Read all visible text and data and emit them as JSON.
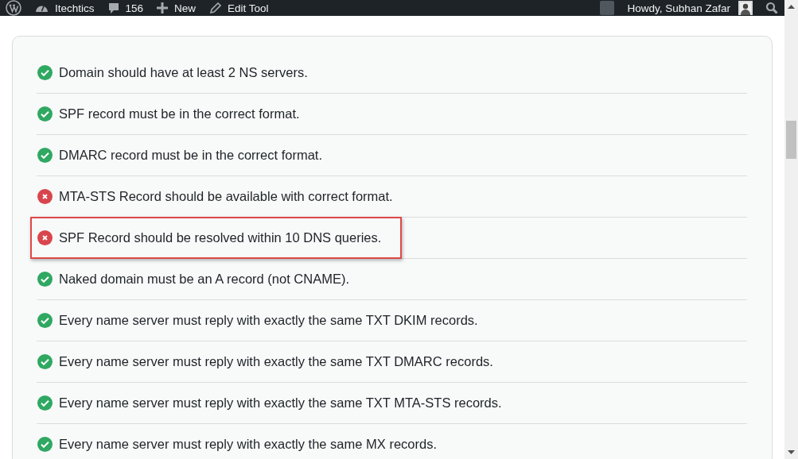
{
  "admin_bar": {
    "site_name": "Itechtics",
    "comments_count": "156",
    "new_label": "New",
    "edit_label": "Edit Tool",
    "greeting": "Howdy, Subhan Zafar"
  },
  "checks": [
    {
      "text": "Domain should have at least 2 NS servers.",
      "passed": true,
      "highlighted": false
    },
    {
      "text": "SPF record must be in the correct format.",
      "passed": true,
      "highlighted": false
    },
    {
      "text": "DMARC record must be in the correct format.",
      "passed": true,
      "highlighted": false
    },
    {
      "text": "MTA-STS Record should be available with correct format.",
      "passed": false,
      "highlighted": false
    },
    {
      "text": "SPF Record should be resolved within 10 DNS queries.",
      "passed": false,
      "highlighted": true
    },
    {
      "text": "Naked domain must be an A record (not CNAME).",
      "passed": true,
      "highlighted": false
    },
    {
      "text": "Every name server must reply with exactly the same TXT DKIM records.",
      "passed": true,
      "highlighted": false
    },
    {
      "text": "Every name server must reply with exactly the same TXT DMARC records.",
      "passed": true,
      "highlighted": false
    },
    {
      "text": "Every name server must reply with exactly the same TXT MTA-STS records.",
      "passed": true,
      "highlighted": false
    },
    {
      "text": "Every name server must reply with exactly the same MX records.",
      "passed": true,
      "highlighted": false
    }
  ]
}
